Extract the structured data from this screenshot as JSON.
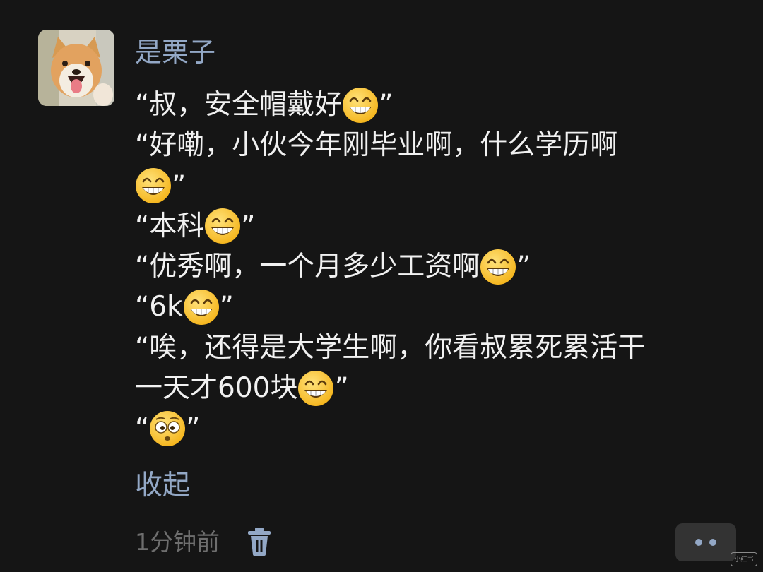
{
  "comment": {
    "author": "是栗子",
    "lines": [
      {
        "before": "“叔，安全帽戴好",
        "emoji": "grinning-face-emoji",
        "after": "”"
      },
      {
        "before": "“好嘞，小伙今年刚毕业啊，什么学历啊",
        "emoji": "",
        "after": ""
      },
      {
        "before": "",
        "emoji": "grinning-face-emoji",
        "after": "”"
      },
      {
        "before": "“本科",
        "emoji": "grinning-face-emoji",
        "after": "”"
      },
      {
        "before": "“优秀啊，一个月多少工资啊",
        "emoji": "grinning-face-emoji",
        "after": "”"
      },
      {
        "before": "“6k",
        "emoji": "grinning-face-emoji",
        "after": "”"
      },
      {
        "before": "“唉，还得是大学生啊，你看叔累死累活干",
        "emoji": "",
        "after": ""
      },
      {
        "before": "一天才600块",
        "emoji": "grinning-face-emoji",
        "after": "”"
      },
      {
        "before": "“",
        "emoji": "flushed-face-emoji",
        "after": "”"
      }
    ],
    "collapse_label": "收起",
    "timestamp": "1分钟前"
  },
  "icons": {
    "avatar": "shiba-dog-avatar",
    "delete": "trash-icon",
    "more": "more-dots-icon"
  },
  "watermark": "小红书",
  "colors": {
    "background": "#151515",
    "text": "#f1f1f1",
    "accent": "#93a8c6",
    "muted": "#6e6e6e",
    "button_bg": "#333333"
  }
}
